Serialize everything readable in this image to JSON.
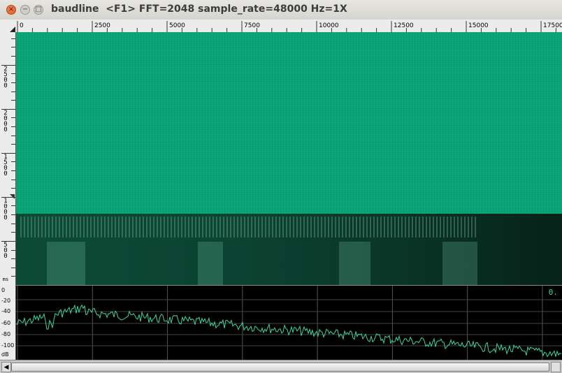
{
  "window": {
    "title": "baudline  <F1> FFT=2048 sample_rate=48000 Hz=1X",
    "close_glyph": "×",
    "minimize_glyph": "−",
    "maximize_glyph": "□"
  },
  "freq_ruler": {
    "ticks": [
      {
        "label": "0",
        "value": 0
      },
      {
        "label": "2500",
        "value": 2500
      },
      {
        "label": "5000",
        "value": 5000
      },
      {
        "label": "7500",
        "value": 7500
      },
      {
        "label": "10000",
        "value": 10000
      },
      {
        "label": "12500",
        "value": 12500
      },
      {
        "label": "15000",
        "value": 15000
      },
      {
        "label": "17500",
        "value": 17500
      }
    ],
    "max_visible": 18200
  },
  "time_ruler": {
    "labels": [
      {
        "text": "2500",
        "value": 2500
      },
      {
        "text": "2000",
        "value": 2000
      },
      {
        "text": "1500",
        "value": 1500
      },
      {
        "text": "1000",
        "value": 1000
      },
      {
        "text": "500",
        "value": 500
      }
    ],
    "unit": "ms"
  },
  "spectrum_ruler": {
    "labels": [
      "0",
      "-20",
      "-40",
      "-60",
      "-80",
      "-100"
    ],
    "unit": "dB",
    "readout": "0."
  },
  "colors": {
    "spectrogram_green": "#0aa577",
    "trace": "#3fd6a4"
  },
  "icons": {
    "close": "close-icon",
    "minimize": "minimize-icon",
    "maximize": "maximize-icon",
    "scroll_left": "arrow-left-icon"
  },
  "scrollbar": {
    "left_glyph": "◀"
  }
}
